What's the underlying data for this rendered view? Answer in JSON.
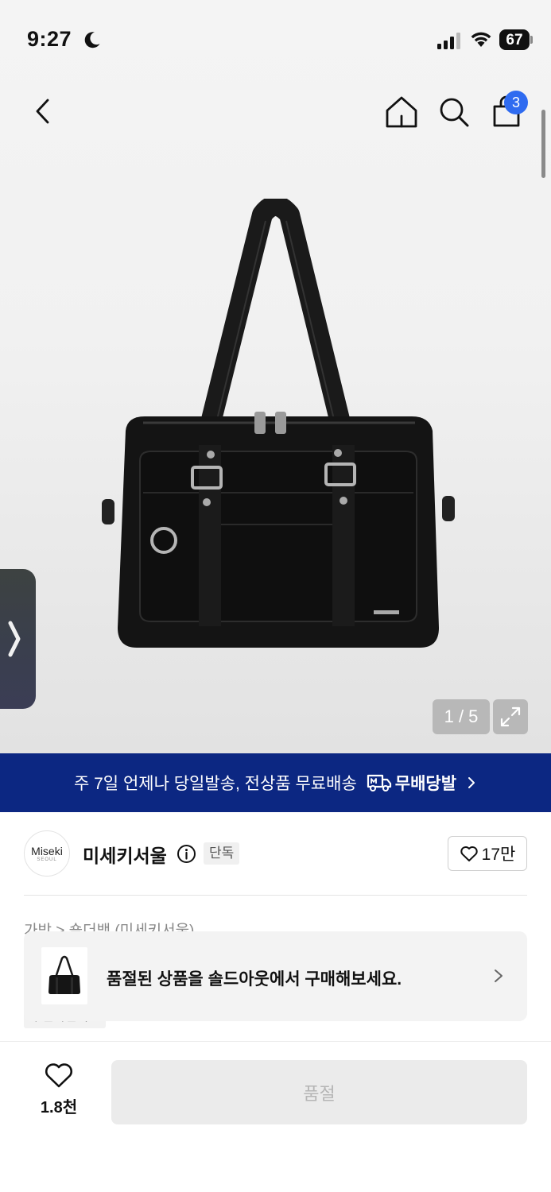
{
  "status_bar": {
    "time": "9:27",
    "battery": "67",
    "icons": [
      "moon-icon",
      "signal-icon",
      "wifi-icon",
      "battery-icon"
    ]
  },
  "nav": {
    "cart_badge": "3",
    "icons": [
      "back-chevron-icon",
      "home-icon",
      "search-icon",
      "shopping-bag-icon"
    ]
  },
  "gallery": {
    "counter": "1 / 5",
    "image": "black-shoulder-school-bag",
    "icons": [
      "side-tab-chevron-icon",
      "expand-icon"
    ]
  },
  "banner": {
    "text": "주 7일 언제나 당일발송, 전상품 무료배송",
    "brand": "무배당발",
    "accent_color": "#0c2782",
    "icons": [
      "truck-icon",
      "chevron-right-icon"
    ]
  },
  "brand": {
    "logo_text": "Miseki",
    "logo_sub": "SEOUL",
    "name": "미세키서울",
    "badge": "단독",
    "like_count": "17만",
    "icons": [
      "info-icon",
      "heart-icon"
    ]
  },
  "breadcrumb": {
    "text": "가방 > 숄더백 (미세키서울)"
  },
  "hidden_tag": {
    "text": "무신사단독"
  },
  "soldout_popup": {
    "message": "품절된 상품을 솔드아웃에서 구매해보세요.",
    "icons": [
      "chevron-right-icon"
    ]
  },
  "bottom_bar": {
    "wish_count": "1.8천",
    "buy_button_label": "품절",
    "icons": [
      "heart-icon"
    ]
  }
}
